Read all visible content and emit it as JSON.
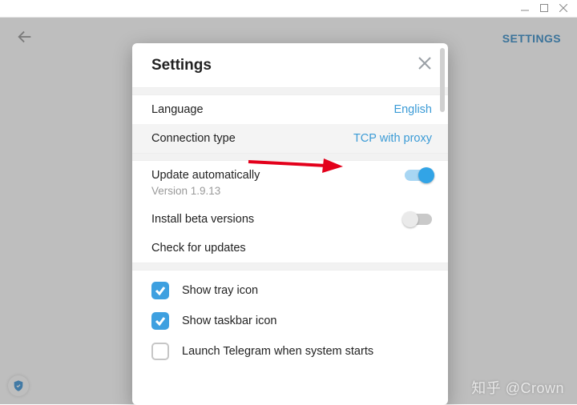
{
  "window": {
    "settings_link": "SETTINGS"
  },
  "modal": {
    "title": "Settings",
    "rows": {
      "language": {
        "label": "Language",
        "value": "English"
      },
      "connection": {
        "label": "Connection type",
        "value": "TCP with proxy"
      },
      "update_auto": {
        "label": "Update automatically",
        "version": "Version 1.9.13"
      },
      "install_beta": {
        "label": "Install beta versions"
      },
      "check_updates": {
        "label": "Check for updates"
      }
    },
    "checks": {
      "tray": "Show tray icon",
      "taskbar": "Show taskbar icon",
      "launch": "Launch Telegram when system starts"
    }
  },
  "watermark": "知乎 @Crown"
}
